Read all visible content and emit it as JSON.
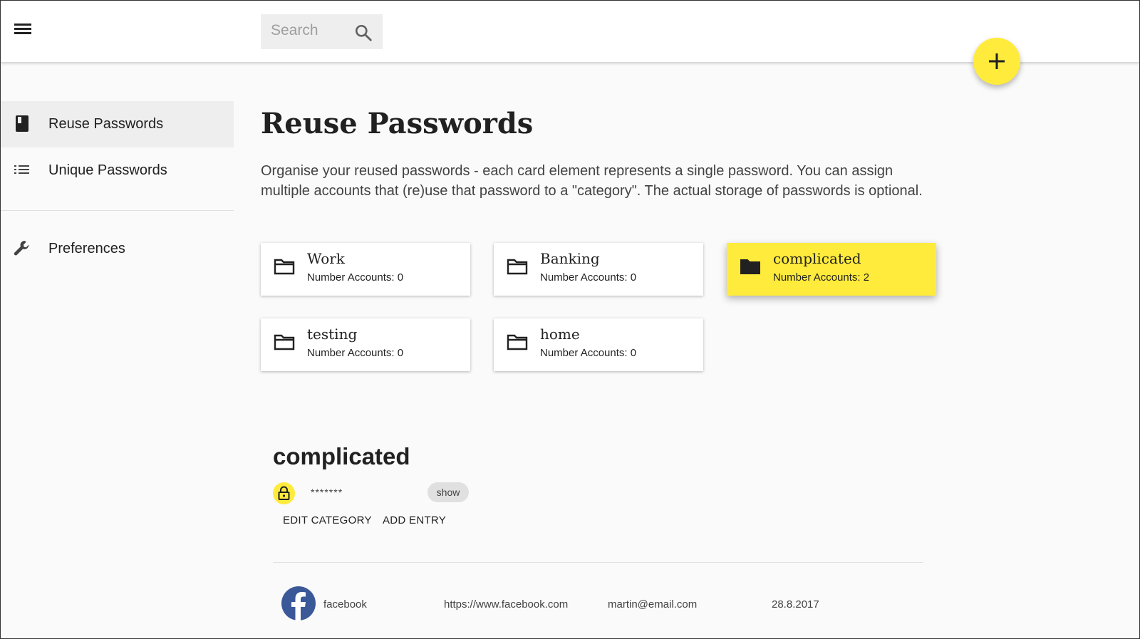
{
  "topbar": {
    "search_placeholder": "Search"
  },
  "sidebar": {
    "items": [
      {
        "label": "Reuse Passwords",
        "icon": "book-icon",
        "active": true
      },
      {
        "label": "Unique Passwords",
        "icon": "list-icon",
        "active": false
      },
      {
        "label": "Preferences",
        "icon": "wrench-icon",
        "active": false
      }
    ]
  },
  "main": {
    "title": "Reuse Passwords",
    "description": "Organise your reused passwords - each card element represents a single password. You can assign multiple accounts that (re)use that password to a \"category\". The actual storage of passwords is optional.",
    "cards": [
      {
        "name": "Work",
        "count": "Number Accounts: 0",
        "selected": false
      },
      {
        "name": "Banking",
        "count": "Number Accounts: 0",
        "selected": false
      },
      {
        "name": "complicated",
        "count": "Number Accounts: 2",
        "selected": true
      },
      {
        "name": "testing",
        "count": "Number Accounts: 0",
        "selected": false
      },
      {
        "name": "home",
        "count": "Number Accounts: 0",
        "selected": false
      }
    ]
  },
  "category": {
    "title": "complicated",
    "password_mask": "*******",
    "show_label": "show",
    "edit_label": "EDIT CATEGORY",
    "add_label": "ADD ENTRY",
    "entries": [
      {
        "name": "facebook",
        "url": "https://www.facebook.com",
        "email": "martin@email.com",
        "date": "28.8.2017",
        "icon": "facebook-icon"
      }
    ]
  },
  "colors": {
    "accent": "#ffeb3b",
    "active_bg": "#eeeeee",
    "facebook": "#3b5998"
  }
}
